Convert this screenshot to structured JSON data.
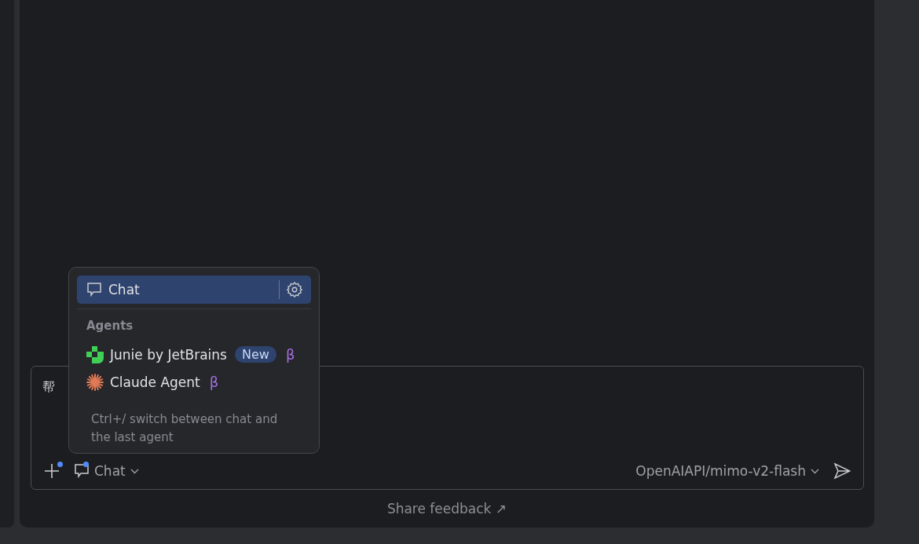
{
  "input": {
    "value": "帮"
  },
  "toolbar": {
    "mode_label": "Chat",
    "model_label": "OpenAIAPI/mimo-v2-flash",
    "attach_dot": true,
    "mode_dot": true
  },
  "mode_menu": {
    "items": [
      {
        "label": "Chat",
        "selected": true
      }
    ],
    "section_title": "Agents",
    "agents": [
      {
        "kind": "junie",
        "label": "Junie by JetBrains",
        "badge": "New",
        "beta": "β",
        "selected": false
      },
      {
        "kind": "claude",
        "label": "Claude Agent",
        "beta": "β",
        "selected": false
      }
    ],
    "hint": "Ctrl+/ switch between chat and the last agent"
  },
  "footer": {
    "link": "Share feedback ↗"
  }
}
